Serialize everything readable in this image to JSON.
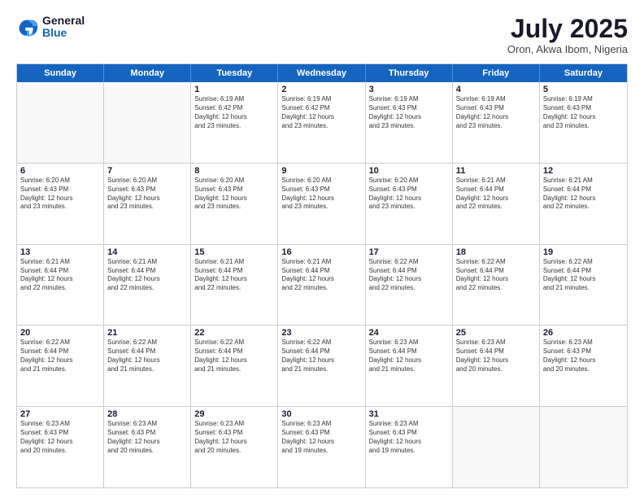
{
  "logo": {
    "general": "General",
    "blue": "Blue"
  },
  "header": {
    "month": "July 2025",
    "location": "Oron, Akwa Ibom, Nigeria"
  },
  "weekdays": [
    "Sunday",
    "Monday",
    "Tuesday",
    "Wednesday",
    "Thursday",
    "Friday",
    "Saturday"
  ],
  "rows": [
    [
      {
        "day": "",
        "empty": true
      },
      {
        "day": "",
        "empty": true
      },
      {
        "day": "1",
        "info": "Sunrise: 6:19 AM\nSunset: 6:42 PM\nDaylight: 12 hours\nand 23 minutes."
      },
      {
        "day": "2",
        "info": "Sunrise: 6:19 AM\nSunset: 6:42 PM\nDaylight: 12 hours\nand 23 minutes."
      },
      {
        "day": "3",
        "info": "Sunrise: 6:19 AM\nSunset: 6:43 PM\nDaylight: 12 hours\nand 23 minutes."
      },
      {
        "day": "4",
        "info": "Sunrise: 6:19 AM\nSunset: 6:43 PM\nDaylight: 12 hours\nand 23 minutes."
      },
      {
        "day": "5",
        "info": "Sunrise: 6:19 AM\nSunset: 6:43 PM\nDaylight: 12 hours\nand 23 minutes."
      }
    ],
    [
      {
        "day": "6",
        "info": "Sunrise: 6:20 AM\nSunset: 6:43 PM\nDaylight: 12 hours\nand 23 minutes."
      },
      {
        "day": "7",
        "info": "Sunrise: 6:20 AM\nSunset: 6:43 PM\nDaylight: 12 hours\nand 23 minutes."
      },
      {
        "day": "8",
        "info": "Sunrise: 6:20 AM\nSunset: 6:43 PM\nDaylight: 12 hours\nand 23 minutes."
      },
      {
        "day": "9",
        "info": "Sunrise: 6:20 AM\nSunset: 6:43 PM\nDaylight: 12 hours\nand 23 minutes."
      },
      {
        "day": "10",
        "info": "Sunrise: 6:20 AM\nSunset: 6:43 PM\nDaylight: 12 hours\nand 23 minutes."
      },
      {
        "day": "11",
        "info": "Sunrise: 6:21 AM\nSunset: 6:44 PM\nDaylight: 12 hours\nand 22 minutes."
      },
      {
        "day": "12",
        "info": "Sunrise: 6:21 AM\nSunset: 6:44 PM\nDaylight: 12 hours\nand 22 minutes."
      }
    ],
    [
      {
        "day": "13",
        "info": "Sunrise: 6:21 AM\nSunset: 6:44 PM\nDaylight: 12 hours\nand 22 minutes."
      },
      {
        "day": "14",
        "info": "Sunrise: 6:21 AM\nSunset: 6:44 PM\nDaylight: 12 hours\nand 22 minutes."
      },
      {
        "day": "15",
        "info": "Sunrise: 6:21 AM\nSunset: 6:44 PM\nDaylight: 12 hours\nand 22 minutes."
      },
      {
        "day": "16",
        "info": "Sunrise: 6:21 AM\nSunset: 6:44 PM\nDaylight: 12 hours\nand 22 minutes."
      },
      {
        "day": "17",
        "info": "Sunrise: 6:22 AM\nSunset: 6:44 PM\nDaylight: 12 hours\nand 22 minutes."
      },
      {
        "day": "18",
        "info": "Sunrise: 6:22 AM\nSunset: 6:44 PM\nDaylight: 12 hours\nand 22 minutes."
      },
      {
        "day": "19",
        "info": "Sunrise: 6:22 AM\nSunset: 6:44 PM\nDaylight: 12 hours\nand 21 minutes."
      }
    ],
    [
      {
        "day": "20",
        "info": "Sunrise: 6:22 AM\nSunset: 6:44 PM\nDaylight: 12 hours\nand 21 minutes."
      },
      {
        "day": "21",
        "info": "Sunrise: 6:22 AM\nSunset: 6:44 PM\nDaylight: 12 hours\nand 21 minutes."
      },
      {
        "day": "22",
        "info": "Sunrise: 6:22 AM\nSunset: 6:44 PM\nDaylight: 12 hours\nand 21 minutes."
      },
      {
        "day": "23",
        "info": "Sunrise: 6:22 AM\nSunset: 6:44 PM\nDaylight: 12 hours\nand 21 minutes."
      },
      {
        "day": "24",
        "info": "Sunrise: 6:23 AM\nSunset: 6:44 PM\nDaylight: 12 hours\nand 21 minutes."
      },
      {
        "day": "25",
        "info": "Sunrise: 6:23 AM\nSunset: 6:44 PM\nDaylight: 12 hours\nand 20 minutes."
      },
      {
        "day": "26",
        "info": "Sunrise: 6:23 AM\nSunset: 6:43 PM\nDaylight: 12 hours\nand 20 minutes."
      }
    ],
    [
      {
        "day": "27",
        "info": "Sunrise: 6:23 AM\nSunset: 6:43 PM\nDaylight: 12 hours\nand 20 minutes."
      },
      {
        "day": "28",
        "info": "Sunrise: 6:23 AM\nSunset: 6:43 PM\nDaylight: 12 hours\nand 20 minutes."
      },
      {
        "day": "29",
        "info": "Sunrise: 6:23 AM\nSunset: 6:43 PM\nDaylight: 12 hours\nand 20 minutes."
      },
      {
        "day": "30",
        "info": "Sunrise: 6:23 AM\nSunset: 6:43 PM\nDaylight: 12 hours\nand 19 minutes."
      },
      {
        "day": "31",
        "info": "Sunrise: 6:23 AM\nSunset: 6:43 PM\nDaylight: 12 hours\nand 19 minutes."
      },
      {
        "day": "",
        "empty": true
      },
      {
        "day": "",
        "empty": true
      }
    ]
  ]
}
